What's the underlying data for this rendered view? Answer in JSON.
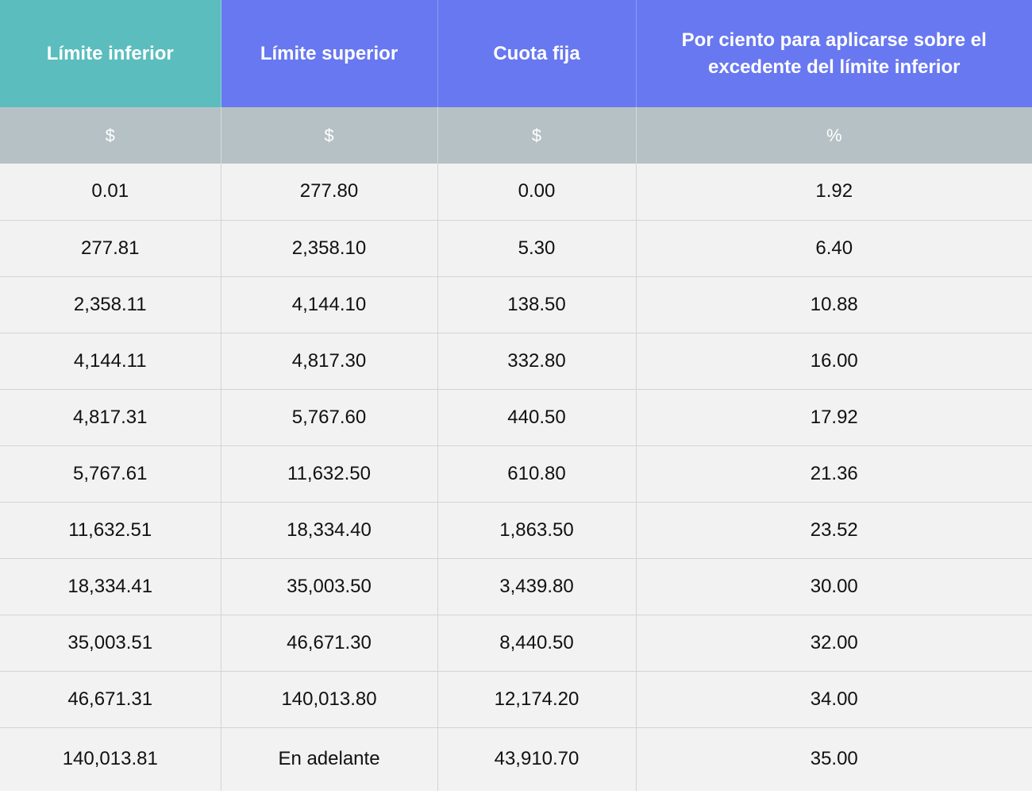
{
  "headers": [
    "Límite inferior",
    "Límite superior",
    "Cuota fija",
    "Por ciento para aplicarse sobre el excedente del límite inferior"
  ],
  "units": [
    "$",
    "$",
    "$",
    "%"
  ],
  "rows": [
    [
      "0.01",
      "277.80",
      "0.00",
      "1.92"
    ],
    [
      "277.81",
      "2,358.10",
      "5.30",
      "6.40"
    ],
    [
      "2,358.11",
      "4,144.10",
      "138.50",
      "10.88"
    ],
    [
      "4,144.11",
      "4,817.30",
      "332.80",
      "16.00"
    ],
    [
      "4,817.31",
      "5,767.60",
      "440.50",
      "17.92"
    ],
    [
      "5,767.61",
      "11,632.50",
      "610.80",
      "21.36"
    ],
    [
      "11,632.51",
      "18,334.40",
      "1,863.50",
      "23.52"
    ],
    [
      "18,334.41",
      "35,003.50",
      "3,439.80",
      "30.00"
    ],
    [
      "35,003.51",
      "46,671.30",
      "8,440.50",
      "32.00"
    ],
    [
      "46,671.31",
      "140,013.80",
      "12,174.20",
      "34.00"
    ],
    [
      "140,013.81",
      "En adelante",
      "43,910.70",
      "35.00"
    ]
  ],
  "colors": {
    "header_first": "#5bbdbe",
    "header_other": "#6878f0",
    "units_row": "#b6c1c5",
    "data_row": "#f2f2f2"
  }
}
